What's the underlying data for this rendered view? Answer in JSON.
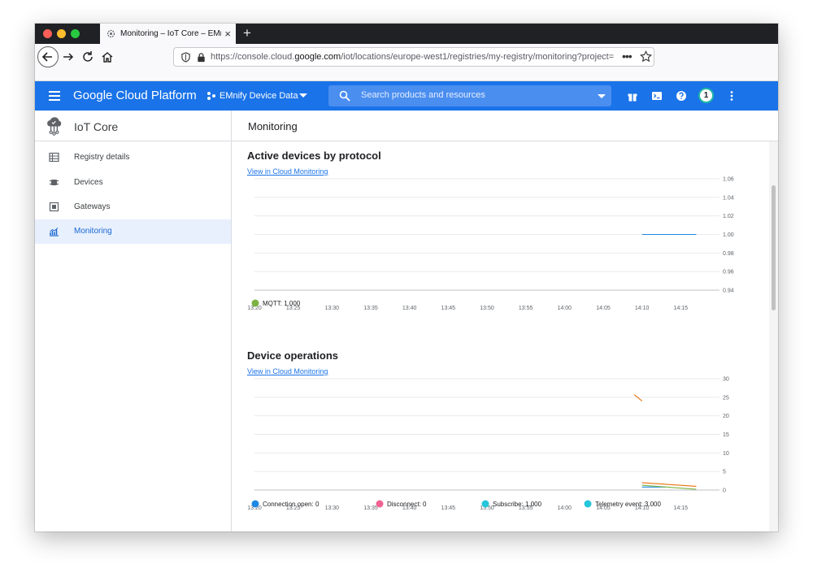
{
  "browser": {
    "tab_title": "Monitoring – IoT Core – EMnify Device Data",
    "tab_close": "×",
    "new_tab": "+",
    "url_prefix": "https://console.cloud.",
    "url_host": "google.com",
    "url_path": "/iot/locations/europe-west1/registries/my-registry/monitoring?project=",
    "url_more": "•••"
  },
  "header": {
    "title": "Google Cloud Platform",
    "project": "EMnify Device Data",
    "search_placeholder": "Search products and resources",
    "notification_count": "1",
    "brand_color": "#1a73e8"
  },
  "sidebar": {
    "product": "IoT Core",
    "items": [
      {
        "label": "Registry details",
        "icon": "table-icon"
      },
      {
        "label": "Devices",
        "icon": "chip-icon"
      },
      {
        "label": "Gateways",
        "icon": "gateway-icon"
      },
      {
        "label": "Monitoring",
        "icon": "chart-icon",
        "active": true
      }
    ]
  },
  "main": {
    "title": "Monitoring"
  },
  "chart_data": [
    {
      "type": "line",
      "title": "Active devices by protocol",
      "link": "View in Cloud Monitoring",
      "yticks": [
        "1.06",
        "1.04",
        "1.02",
        "1.00",
        "0.98",
        "0.96",
        "0.94"
      ],
      "ylim": [
        0.94,
        1.06
      ],
      "xticks": [
        "13:20",
        "13:25",
        "13:30",
        "13:35",
        "13:40",
        "13:45",
        "13:50",
        "13:55",
        "14:00",
        "14:05",
        "14:10",
        "14:15"
      ],
      "series": [
        {
          "name": "MQTT",
          "value_label": "1.000",
          "color": "#1e88e5",
          "legend_color": "#7cb342",
          "points": [
            [
              14.1,
              1.0
            ],
            [
              14.17,
              1.0
            ]
          ]
        }
      ],
      "grid": true,
      "legend": "bottom-left"
    },
    {
      "type": "line",
      "title": "Device operations",
      "link": "View in Cloud Monitoring",
      "yticks": [
        "30",
        "25",
        "20",
        "15",
        "10",
        "5",
        "0"
      ],
      "ylim": [
        0,
        30
      ],
      "xticks": [
        "13:20",
        "13:25",
        "13:30",
        "13:35",
        "13:40",
        "13:45",
        "13:50",
        "13:55",
        "14:00",
        "14:05",
        "14:10",
        "14:15"
      ],
      "series": [
        {
          "name": "Connection open",
          "value_label": "0",
          "color": "#1e88e5",
          "points": [
            [
              14.1,
              0.8
            ],
            [
              14.13,
              0.8
            ]
          ]
        },
        {
          "name": "Disconnect",
          "value_label": "0",
          "color": "#f06292",
          "points": []
        },
        {
          "name": "Subscribe",
          "value_label": "1.000",
          "color": "#26c6da",
          "points": []
        },
        {
          "name": "Telemetry event",
          "value_label": "3.000",
          "color": "#26c6da",
          "points": []
        },
        {
          "name": "",
          "value_label": "",
          "color": "#e8710a",
          "points": [
            [
              14.1,
              2.0
            ],
            [
              14.17,
              1.0
            ]
          ]
        },
        {
          "name": "",
          "value_label": "",
          "color": "#7cb342",
          "points": [
            [
              14.1,
              1.3
            ],
            [
              14.17,
              0.2
            ]
          ]
        },
        {
          "name": "",
          "value_label": "",
          "color": "#e8710a",
          "points": [
            [
              14.09,
              25.7
            ],
            [
              14.1,
              24.0
            ]
          ]
        }
      ],
      "grid": true,
      "legend": "bottom"
    }
  ]
}
